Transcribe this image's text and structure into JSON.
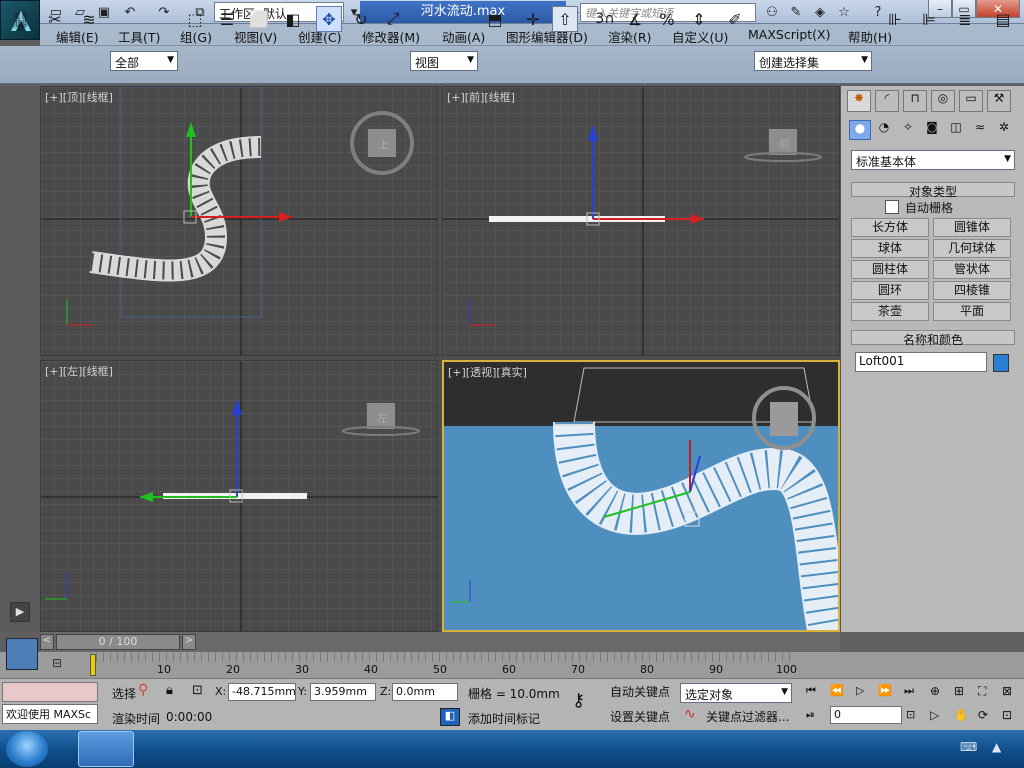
{
  "titlebar": {
    "workspace_label": "工作区: 默认",
    "file_title": "河水流动.max",
    "search_placeholder": "键入关键字或短语"
  },
  "menu": [
    "编辑(E)",
    "工具(T)",
    "组(G)",
    "视图(V)",
    "创建(C)",
    "修改器(M)",
    "动画(A)",
    "图形编辑器(D)",
    "渲染(R)",
    "自定义(U)",
    "MAXScript(X)",
    "帮助(H)"
  ],
  "toolbar": {
    "selection_filter": "全部",
    "ref_coord": "视图",
    "snap_label": "3",
    "named_selection": "创建选择集"
  },
  "viewports": {
    "top": {
      "label": "[+][顶][线框]",
      "cube": "上"
    },
    "front": {
      "label": "[+][前][线框]",
      "cube": "前"
    },
    "left": {
      "label": "[+][左][线框]",
      "cube": "左"
    },
    "persp": {
      "label": "[+][透视][真实]"
    }
  },
  "command_panel": {
    "category": "标准基本体",
    "object_type_header": "对象类型",
    "autogrid_label": "自动栅格",
    "object_types": [
      "长方体",
      "圆锥体",
      "球体",
      "几何球体",
      "圆柱体",
      "管状体",
      "圆环",
      "四棱锥",
      "茶壶",
      "平面"
    ],
    "name_color_header": "名称和颜色",
    "object_name": "Loft001",
    "object_color": "#2a7fd4"
  },
  "timeline": {
    "frame_display": "0 / 100",
    "ticks": [
      "10",
      "20",
      "30",
      "40",
      "50",
      "60",
      "70",
      "80",
      "90",
      "100"
    ]
  },
  "status": {
    "maxscript_text": "欢迎使用 MAXSc",
    "select_prefix": "选择",
    "x_label": "X:",
    "x_value": "-48.715mm",
    "y_label": "Y:",
    "y_value": "3.959mm",
    "z_label": "Z:",
    "z_value": "0.0mm",
    "grid_text": "栅格 = 10.0mm",
    "render_time_label": "渲染时间",
    "render_time_value": "0:00:00",
    "add_time_tag": "添加时间标记",
    "autokey": "自动关键点",
    "setkey": "设置关键点",
    "key_filter_value": "选定对象",
    "key_filters_label": "关键点过滤器...",
    "frame_value": "0"
  },
  "colors": {
    "accent": "#3b6fc2",
    "water": "#4f8fc0",
    "axis_x": "#d42020",
    "axis_y": "#20b020",
    "axis_z": "#2040d0"
  }
}
